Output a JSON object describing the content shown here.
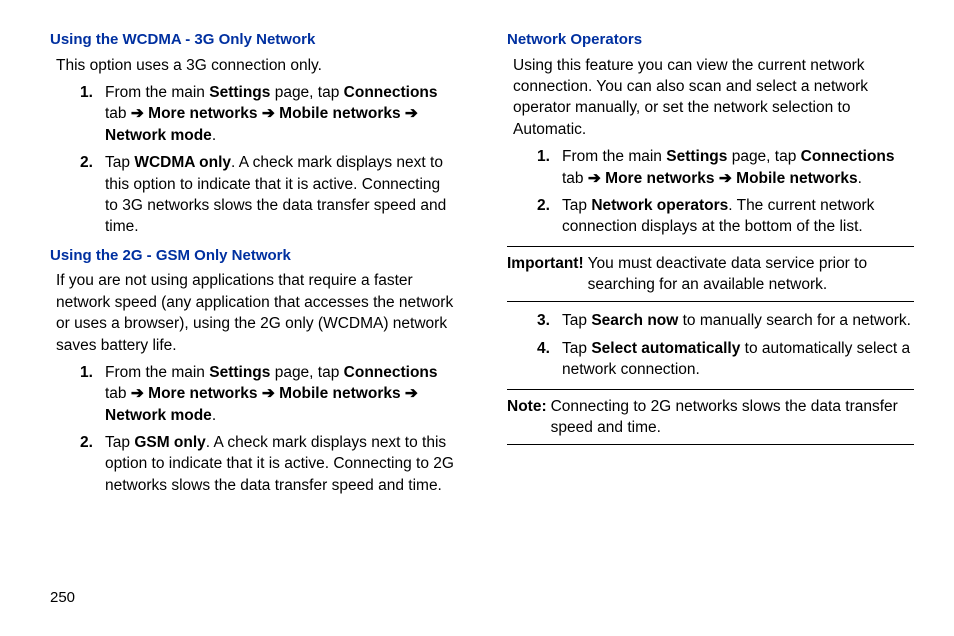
{
  "left": {
    "sec1": {
      "heading": "Using the WCDMA - 3G Only Network",
      "intro": "This option uses a 3G connection only.",
      "step1_a": "From the main ",
      "step1_b": "Settings",
      "step1_c": " page, tap ",
      "step1_d": "Connections",
      "step1_e": " tab ",
      "step1_f": "More networks",
      "step1_g": "Mobile networks",
      "step1_h": "Network mode",
      "step2_a": "Tap ",
      "step2_b": "WCDMA only",
      "step2_c": ". A check mark displays next to this option to indicate that it is active. Connecting to 3G networks slows the data transfer speed and time."
    },
    "sec2": {
      "heading": "Using the 2G - GSM Only Network",
      "intro": "If you are not using applications that require a faster network speed (any application that accesses the network or uses a browser), using the 2G only (WCDMA) network saves battery life.",
      "step1_a": "From the main ",
      "step1_b": "Settings",
      "step1_c": " page, tap ",
      "step1_d": "Connections",
      "step1_e": " tab ",
      "step1_f": "More networks",
      "step1_g": "Mobile networks",
      "step1_h": "Network mode",
      "step2_a": "Tap ",
      "step2_b": "GSM only",
      "step2_c": ". A check mark displays next to this option to indicate that it is active. Connecting to 2G networks slows the data transfer speed and time."
    }
  },
  "right": {
    "sec1": {
      "heading": "Network Operators",
      "intro": "Using this feature you can view the current network connection. You can also scan and select a network operator manually, or set the network selection to Automatic.",
      "step1_a": "From the main ",
      "step1_b": "Settings",
      "step1_c": " page, tap ",
      "step1_d": "Connections",
      "step1_e": " tab ",
      "step1_f": "More networks",
      "step1_g": "Mobile networks",
      "step2_a": "Tap ",
      "step2_b": "Network operators",
      "step2_c": ". The current network connection displays at the bottom of the list."
    },
    "important": {
      "label": "Important!",
      "text": " You must deactivate data service prior to searching for an available network."
    },
    "sec2": {
      "step3_a": "Tap ",
      "step3_b": "Search now",
      "step3_c": " to manually search for a network.",
      "step4_a": "Tap ",
      "step4_b": "Select automatically",
      "step4_c": " to automatically select a network connection."
    },
    "note": {
      "label": "Note:",
      "text": " Connecting to 2G networks slows the data transfer speed and time."
    }
  },
  "arrow": " ➔ ",
  "page_number": "250"
}
